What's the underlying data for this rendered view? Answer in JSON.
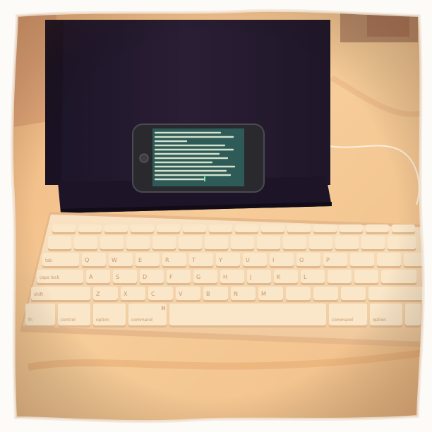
{
  "photo": {
    "colors": {
      "frame": "#fdfbf7",
      "bedspread": "#f4c48c",
      "bedspread_shadow": "#e8a874",
      "stand": "#241a30",
      "stand_highlight": "#3a2a42",
      "phone_body": "#2a2a2e",
      "phone_screen": "#2e5a58",
      "screen_text": "#e8f0d8",
      "keyboard_body": "#f7d9b4",
      "key_top": "#fae6c8",
      "key_edge": "#e2b98c",
      "key_legend": "#c8966a"
    }
  },
  "keyboard": {
    "labels": {
      "tab": "tab",
      "caps_lock": "caps lock",
      "shift": "shift",
      "fn": "fn",
      "control": "control",
      "option": "option",
      "command_glyph": "⌘",
      "command": "command",
      "command_right": "command",
      "option_right": "option",
      "letters_row2": [
        "Q",
        "W",
        "E",
        "R",
        "T",
        "Y",
        "U",
        "I",
        "O",
        "P"
      ],
      "letters_row3": [
        "A",
        "S",
        "D",
        "F",
        "G",
        "H",
        "J",
        "K",
        "L"
      ],
      "letters_row4": [
        "Z",
        "X",
        "C",
        "V",
        "B",
        "N",
        "M"
      ]
    }
  }
}
